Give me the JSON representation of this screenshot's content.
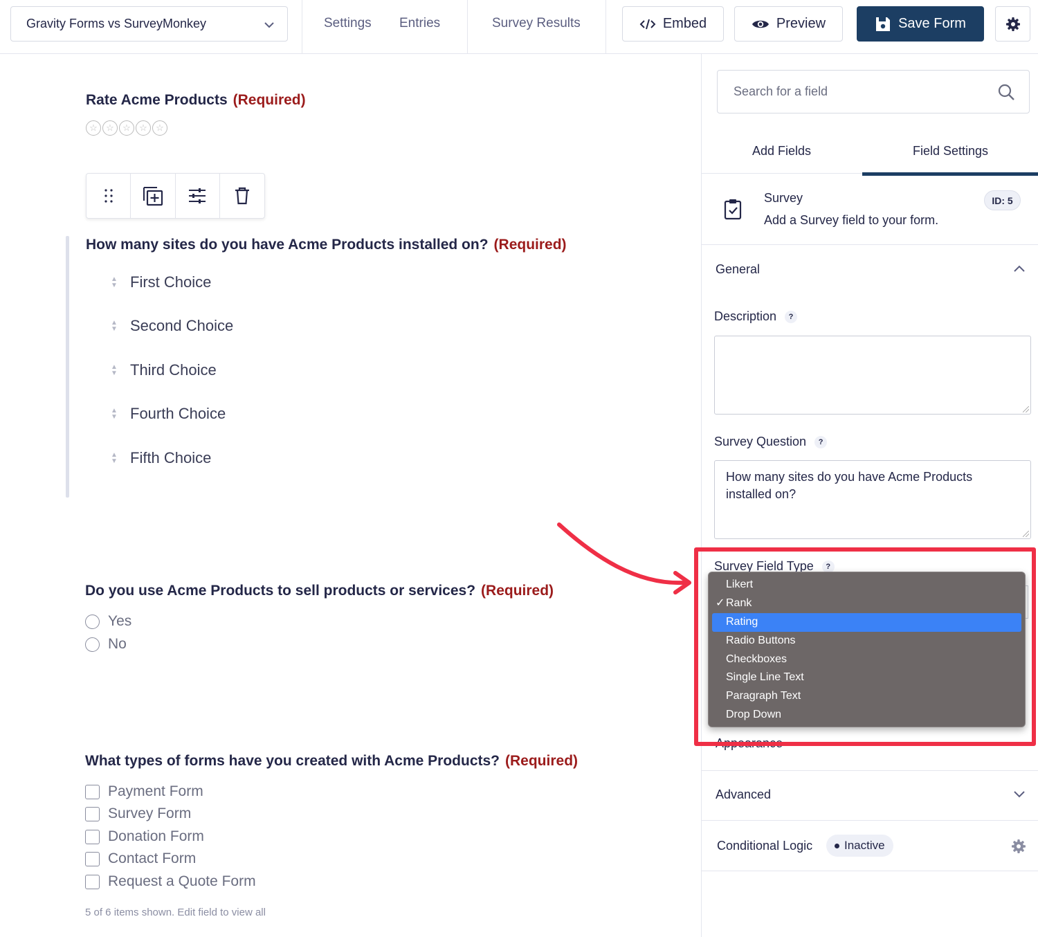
{
  "header": {
    "form_name": "Gravity Forms vs SurveyMonkey",
    "nav": {
      "settings": "Settings",
      "entries": "Entries",
      "survey_results": "Survey Results"
    },
    "embed_label": "Embed",
    "preview_label": "Preview",
    "save_label": "Save Form"
  },
  "canvas": {
    "required_label": "(Required)",
    "rating_field": {
      "title": "Rate Acme Products",
      "star_count": 5
    },
    "rank_field": {
      "title": "How many sites do you have Acme Products installed on?",
      "choices": [
        "First Choice",
        "Second Choice",
        "Third Choice",
        "Fourth Choice",
        "Fifth Choice"
      ]
    },
    "radio_field": {
      "title": "Do you use Acme Products to sell products or services?",
      "choices": [
        "Yes",
        "No"
      ]
    },
    "checkbox_field": {
      "title": "What types of forms have you created with Acme Products?",
      "choices": [
        "Payment Form",
        "Survey Form",
        "Donation Form",
        "Contact Form",
        "Request a Quote Form"
      ],
      "note": "5 of 6 items shown. Edit field to view all"
    }
  },
  "sidebar": {
    "search_placeholder": "Search for a field",
    "tabs": {
      "add_fields": "Add Fields",
      "field_settings": "Field Settings"
    },
    "field_info": {
      "title": "Survey",
      "description": "Add a Survey field to your form.",
      "id_badge": "ID: 5"
    },
    "general": {
      "title": "General",
      "description_label": "Description",
      "description_value": "",
      "question_label": "Survey Question",
      "question_value": "How many sites do you have Acme Products installed on?",
      "field_type_label": "Survey Field Type",
      "field_type_options": [
        "Likert",
        "Rank",
        "Rating",
        "Radio Buttons",
        "Checkboxes",
        "Single Line Text",
        "Paragraph Text",
        "Drop Down"
      ],
      "field_type_checked": "Rank",
      "field_type_hovered": "Rating",
      "help": "?"
    },
    "appearance_title": "Appearance",
    "advanced_title": "Advanced",
    "conditional_logic": {
      "title": "Conditional Logic",
      "status": "Inactive"
    }
  },
  "colors": {
    "brand": "#1c3e63",
    "required": "#9b1b1b",
    "highlight": "#ef2f46",
    "menu_bg": "#6d6767",
    "menu_selected": "#3b82f6"
  }
}
